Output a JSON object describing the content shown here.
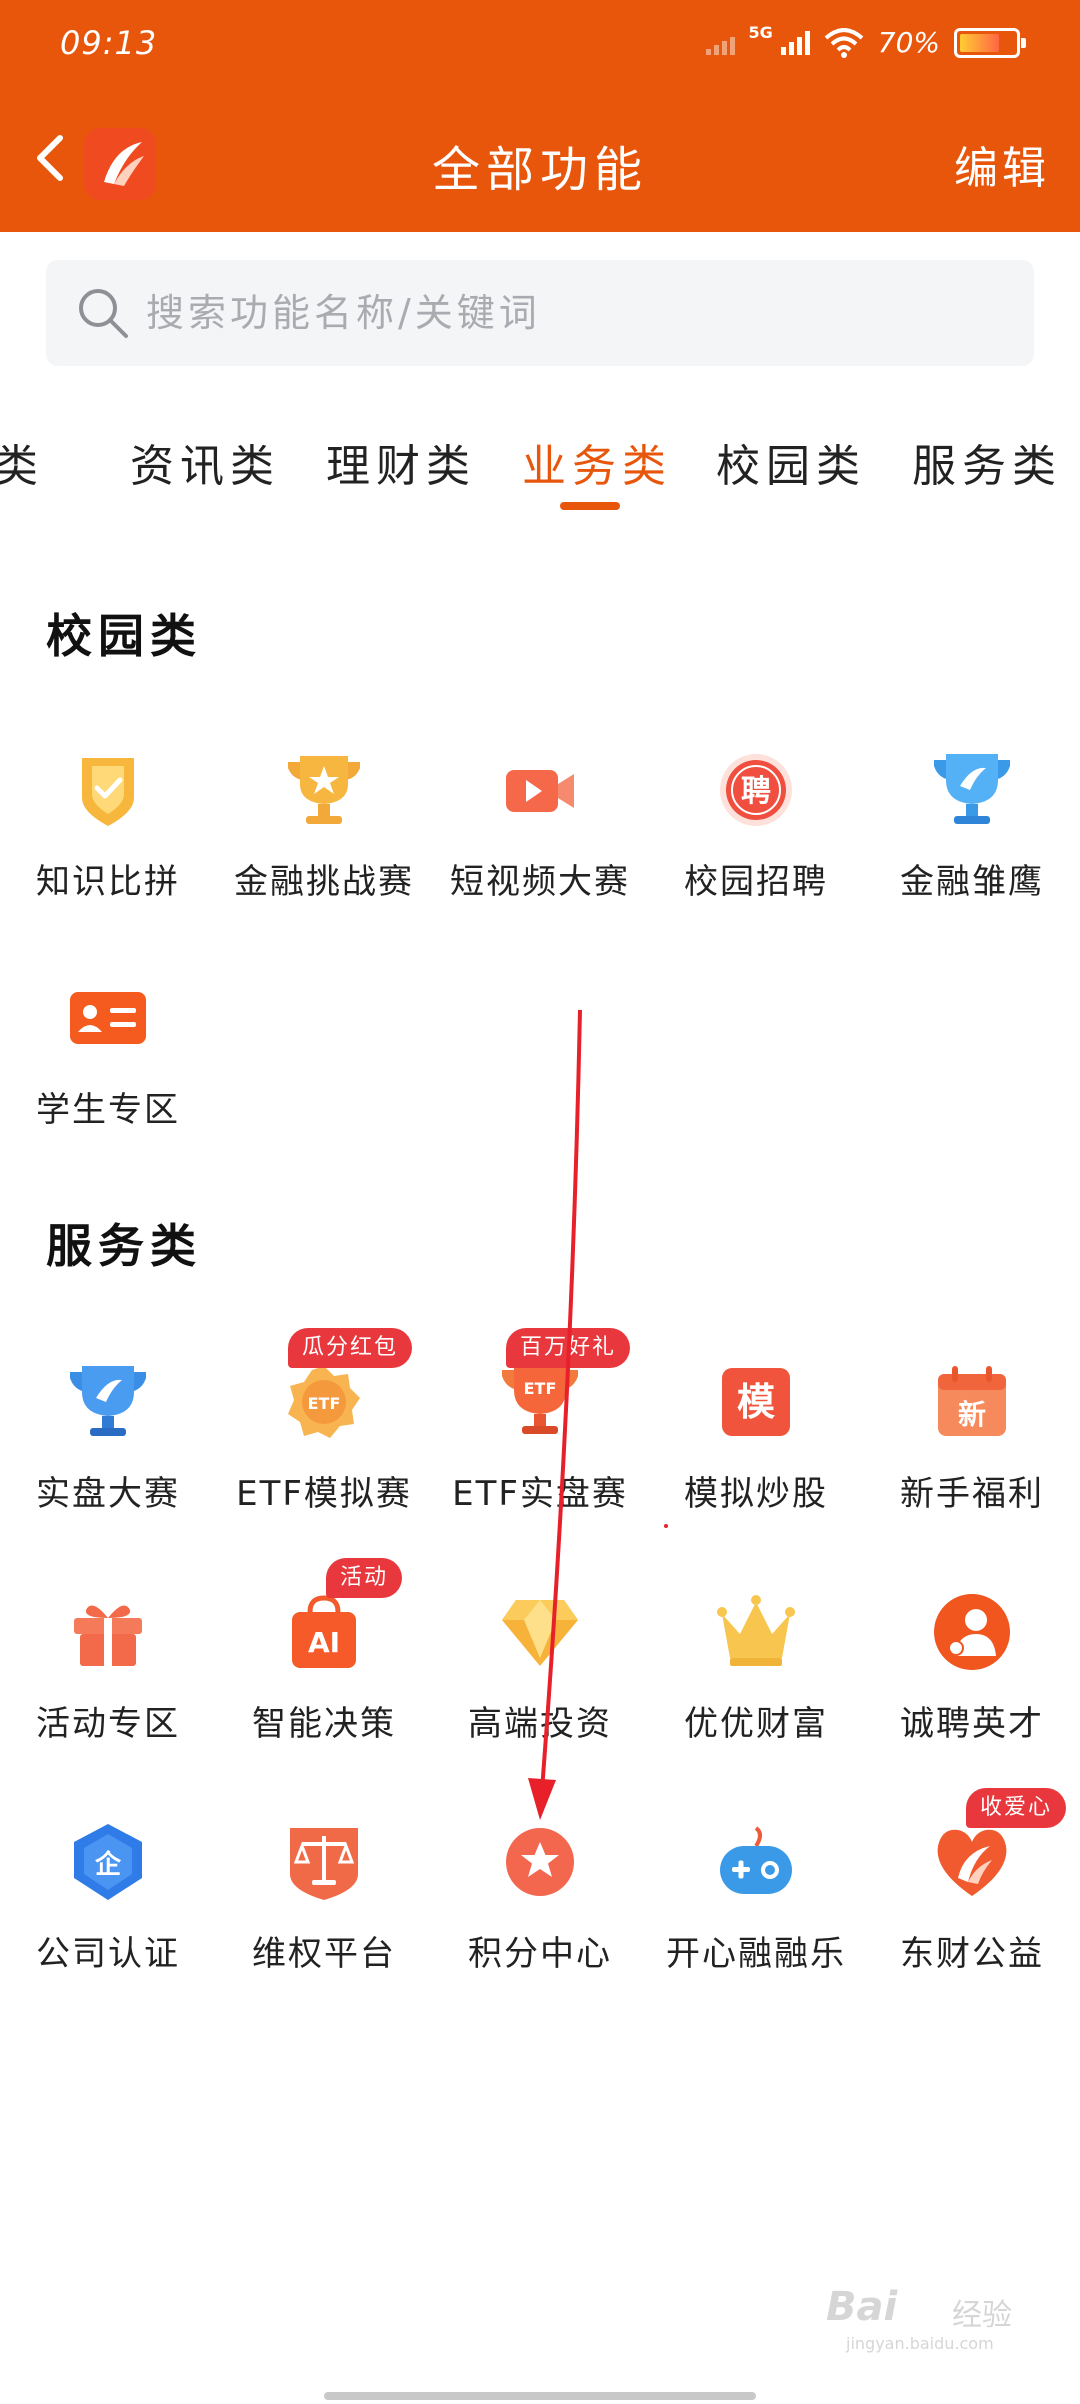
{
  "status_bar": {
    "time": "09:13",
    "network": "5G",
    "battery": "70%"
  },
  "header": {
    "title": "全部功能",
    "edit_label": "编辑"
  },
  "search": {
    "placeholder": "搜索功能名称/关键词",
    "value": ""
  },
  "tabs": [
    {
      "label": "话类"
    },
    {
      "label": "资讯类"
    },
    {
      "label": "理财类"
    },
    {
      "label": "业务类",
      "active": true
    },
    {
      "label": "校园类"
    },
    {
      "label": "服务类"
    }
  ],
  "sections": [
    {
      "title": "校园类",
      "items": [
        {
          "label": "知识比拼",
          "icon": "badge-check-icon"
        },
        {
          "label": "金融挑战赛",
          "icon": "trophy-star-icon"
        },
        {
          "label": "短视频大赛",
          "icon": "video-camera-icon"
        },
        {
          "label": "校园招聘",
          "icon": "recruit-icon",
          "icon_text": "聘"
        },
        {
          "label": "金融雏鹰",
          "icon": "trophy-icon"
        },
        {
          "label": "学生专区",
          "icon": "student-card-icon"
        }
      ]
    },
    {
      "title": "服务类",
      "items": [
        {
          "label": "实盘大赛",
          "icon": "trophy-icon"
        },
        {
          "label": "ETF模拟赛",
          "icon": "etf-medal-icon",
          "icon_text": "ETF",
          "badge": "瓜分红包"
        },
        {
          "label": "ETF实盘赛",
          "icon": "etf-cup-icon",
          "icon_text": "ETF",
          "badge": "百万好礼"
        },
        {
          "label": "模拟炒股",
          "icon": "simulate-icon",
          "icon_text": "模"
        },
        {
          "label": "新手福利",
          "icon": "calendar-new-icon",
          "icon_text": "新"
        },
        {
          "label": "活动专区",
          "icon": "gift-icon"
        },
        {
          "label": "智能决策",
          "icon": "ai-bag-icon",
          "icon_text": "AI",
          "badge": "活动"
        },
        {
          "label": "高端投资",
          "icon": "diamond-icon"
        },
        {
          "label": "优优财富",
          "icon": "crown-icon"
        },
        {
          "label": "诚聘英才",
          "icon": "talent-icon"
        },
        {
          "label": "公司认证",
          "icon": "shield-verify-icon",
          "icon_text": "企"
        },
        {
          "label": "维权平台",
          "icon": "scales-icon"
        },
        {
          "label": "积分中心",
          "icon": "points-star-icon"
        },
        {
          "label": "开心融融乐",
          "icon": "gamepad-icon"
        },
        {
          "label": "东财公益",
          "icon": "charity-heart-icon",
          "badge": "收爱心"
        }
      ]
    }
  ],
  "watermark": {
    "brand": "Bai",
    "cn": "经验",
    "url": "jingyan.baidu.com"
  },
  "colors": {
    "brand": "#e8560c",
    "badge": "#e8383d",
    "arrow": "#e8202a"
  }
}
